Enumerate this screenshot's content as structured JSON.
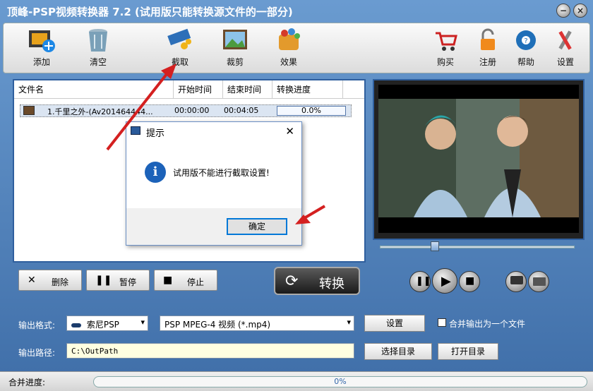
{
  "app": {
    "title": "顶峰-PSP视频转换器 7.2 (试用版只能转换源文件的一部分)"
  },
  "toolbar": {
    "add_label": "添加",
    "clear_label": "清空",
    "capture_label": "截取",
    "crop_label": "裁剪",
    "effect_label": "效果",
    "buy_label": "购买",
    "register_label": "注册",
    "help_label": "帮助",
    "settings_label": "设置"
  },
  "file_list": {
    "columns": [
      "文件名",
      "开始时间",
      "结束时间",
      "转换进度"
    ],
    "rows": [
      {
        "name": "1.千里之外-(Av201464444...",
        "start": "00:00:00",
        "end": "00:04:05",
        "progress": "0.0%"
      }
    ]
  },
  "actions": {
    "delete_label": "删除",
    "pause_label": "暂停",
    "stop_label": "停止",
    "convert_label": "转换"
  },
  "output": {
    "format_label": "输出格式:",
    "device_value": "索尼PSP",
    "format_value": "PSP MPEG-4 视频 (*.mp4)",
    "settings_button": "设置",
    "merge_checkbox_label": "合并输出为一个文件",
    "path_label": "输出路径:",
    "path_value": "C:\\OutPath",
    "browse_button": "选择目录",
    "open_button": "打开目录"
  },
  "status": {
    "merge_label": "合并进度:",
    "merge_progress": "0%"
  },
  "dialog": {
    "title": "提示",
    "message": "试用版不能进行截取设置!",
    "ok_label": "确定"
  },
  "colors": {
    "accent": "#2f5f9e",
    "annotation_arrow": "#d42020",
    "info_icon": "#1c62b9"
  }
}
